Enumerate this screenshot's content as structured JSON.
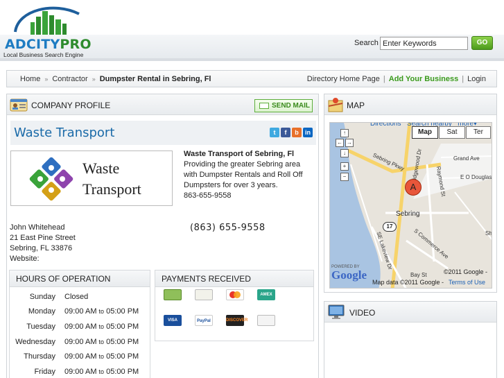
{
  "brand": {
    "name_part1": "ADCITY",
    "name_part2": "PRO",
    "tagline": "Local Business Search Engine"
  },
  "search": {
    "label": "Search",
    "value": "Enter Keywords",
    "go_label": "GO"
  },
  "breadcrumb": {
    "items": [
      "Home",
      "Contractor"
    ],
    "separator": "»",
    "current": "Dumpster Rental in Sebring, Fl"
  },
  "top_links": {
    "directory_home": "Directory Home Page",
    "add_business": "Add Your Business",
    "login": "Login",
    "divider": "|"
  },
  "company_profile": {
    "title": "COMPANY PROFILE",
    "send_mail": "SEND MAIL",
    "business_name": "Waste Transport",
    "social": [
      "t",
      "f",
      "b",
      "in"
    ],
    "logo_words": [
      "Waste",
      "Transport"
    ],
    "description_title": "Waste Transport of Sebring, Fl",
    "description_text": "Providing the greater Sebring area with Dumpster Rentals and Roll Off Dumpsters for over 3 years.",
    "description_phone": "863-655-9558",
    "contact": {
      "name": "John Whitehead",
      "street": "21 East Pine Street",
      "city": "Sebring, FL 33876",
      "website_label": "Website:"
    },
    "big_phone": "(863) 655-9558"
  },
  "hours": {
    "title": "HOURS OF OPERATION",
    "to_word": "to",
    "rows": [
      {
        "day": "Sunday",
        "open": "Closed",
        "close": ""
      },
      {
        "day": "Monday",
        "open": "09:00 AM",
        "close": "05:00 PM"
      },
      {
        "day": "Tuesday",
        "open": "09:00 AM",
        "close": "05:00 PM"
      },
      {
        "day": "Wednesday",
        "open": "09:00 AM",
        "close": "05:00 PM"
      },
      {
        "day": "Thursday",
        "open": "09:00 AM",
        "close": "05:00 PM"
      },
      {
        "day": "Friday",
        "open": "09:00 AM",
        "close": "05:00 PM"
      }
    ]
  },
  "payments": {
    "title": "PAYMENTS RECEIVED",
    "methods": [
      "cash",
      "check",
      "mastercard",
      "AMEX",
      "VISA",
      "PayPal",
      "DISCOVER",
      "other"
    ]
  },
  "map": {
    "title": "MAP",
    "top_links": [
      "Directions",
      "Search nearby",
      "more▾"
    ],
    "types": [
      "Map",
      "Sat",
      "Ter"
    ],
    "active_type": "Map",
    "marker": "A",
    "labels": {
      "sebring": "Sebring",
      "sebring_pkwy": "Sebring Pkwy",
      "ridgewood": "N Ridgewood Dr",
      "raymond": "Raymond St",
      "grand": "Grand Ave",
      "douglas": "E O Douglas",
      "lakeview": "SE Lakeview Dr",
      "commerce": "S Commerce Ave",
      "bay": "Bay St",
      "route": "17",
      "sh": "Sh"
    },
    "powered_by": "POWERED BY",
    "google": "Google",
    "copyright": "©2011 Google -",
    "map_data": "Map data ©2011 Google -",
    "terms": "Terms of Use"
  },
  "video": {
    "title": "VIDEO"
  },
  "colors": {
    "accent_blue": "#1a6aa8",
    "accent_green": "#3a9a1c"
  }
}
